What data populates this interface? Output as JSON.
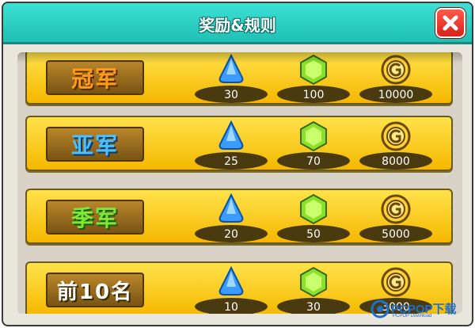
{
  "header": {
    "title": "奖励&规则",
    "close_icon": "close-icon"
  },
  "rewards": [
    {
      "rank": "冠军",
      "rank_color": "#ff9b1a",
      "gems": "30",
      "cubes": "100",
      "coins": "10000"
    },
    {
      "rank": "亚军",
      "rank_color": "#4cc0ff",
      "gems": "25",
      "cubes": "70",
      "coins": "8000"
    },
    {
      "rank": "季军",
      "rank_color": "#7be83a",
      "gems": "20",
      "cubes": "50",
      "coins": "5000"
    },
    {
      "rank": "前10名",
      "rank_color": "#ffffff",
      "gems": "10",
      "cubes": "30",
      "coins": "3000"
    }
  ],
  "icons": {
    "gem": "blue-gem-icon",
    "cube": "green-crystal-icon",
    "coin": "gold-coin-icon"
  },
  "watermark": {
    "text": "PCPOP下载",
    "sub": "PCPOP Download"
  }
}
